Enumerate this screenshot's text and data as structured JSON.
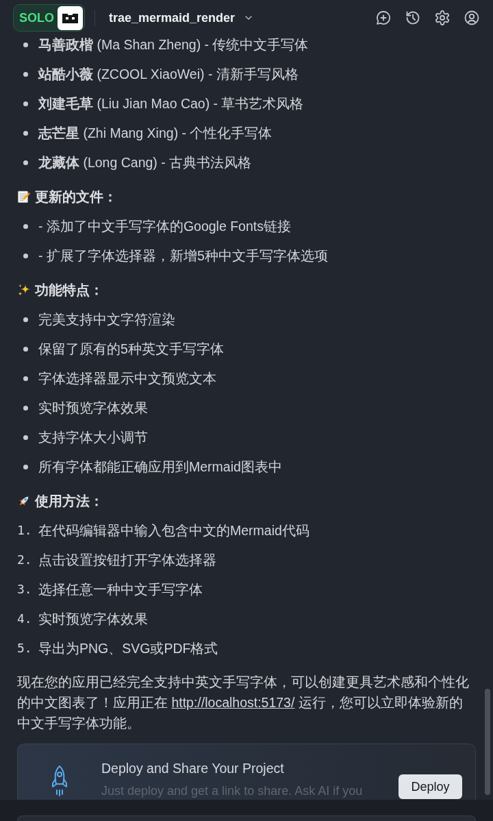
{
  "header": {
    "badge": "SOLO",
    "project": "trae_mermaid_render"
  },
  "content": [
    {
      "kind": "bullets",
      "items": [
        "**马善政楷** (Ma Shan Zheng) - 传统中文手写体",
        "**站酷小薇** (ZCOOL XiaoWei) - 清新手写风格",
        "**刘建毛草** (Liu Jian Mao Cao) - 草书艺术风格",
        "**志芒星** (Zhi Mang Xing) - 个性化手写体",
        "**龙藏体** (Long Cang) - 古典书法风格"
      ]
    },
    {
      "kind": "heading",
      "text": "更新的文件："
    },
    {
      "kind": "bullets",
      "items": [
        "- 添加了中文手写字体的Google Fonts链接",
        "- 扩展了字体选择器，新增5种中文手写字体选项"
      ]
    },
    {
      "kind": "heading",
      "text": "功能特点："
    },
    {
      "kind": "bullets",
      "items": [
        "完美支持中文字符渲染",
        "保留了原有的5种英文手写字体",
        "字体选择器显示中文预览文本",
        "实时预览字体效果",
        "支持字体大小调节",
        "所有字体都能正确应用到Mermaid图表中"
      ]
    },
    {
      "kind": "heading",
      "text": "使用方法："
    },
    {
      "kind": "numbered",
      "items": [
        {
          "number": "1.",
          "text": "在代码编辑器中输入包含中文的Mermaid代码"
        },
        {
          "number": "2.",
          "text": "点击设置按钮打开字体选择器"
        },
        {
          "number": "3.",
          "text": "选择任意一种中文手写字体"
        },
        {
          "number": "4.",
          "text": "实时预览字体效果"
        },
        {
          "number": "5.",
          "text": "导出为PNG、SVG或PDF格式"
        }
      ]
    },
    {
      "kind": "paragraph",
      "before": "现在您的应用已经完全支持中英文手写字体，可以创建更具艺术感和个性化的中文图表了！应用正在 ",
      "link": "http://localhost:5173/",
      "after": " 运行，您可以立即体验新的中文手写字体功能。"
    }
  ],
  "deploy_card": {
    "title": "Deploy and Share Your Project",
    "subtitle": "Just deploy and get a link to share. Ask AI if you",
    "button": "Deploy"
  }
}
